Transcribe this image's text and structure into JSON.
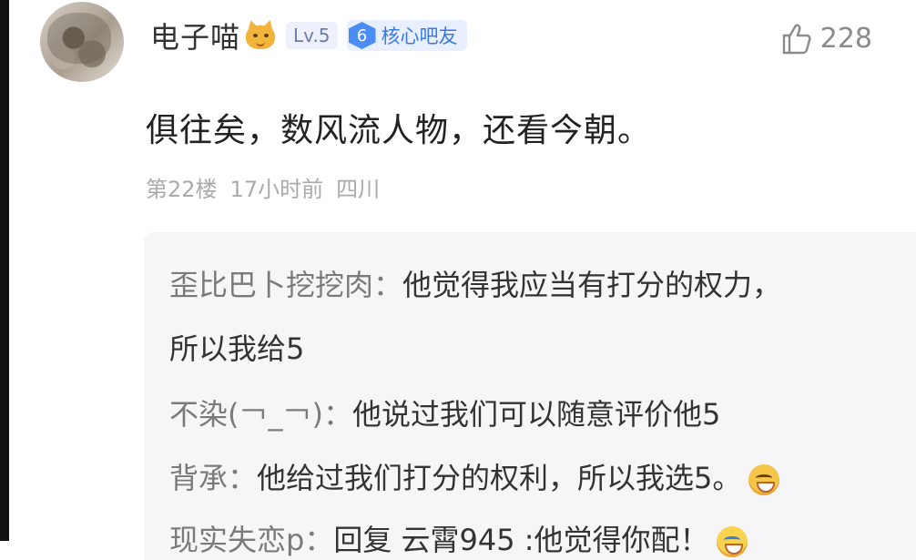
{
  "comment": {
    "username": "电子喵",
    "level": "Lv.5",
    "member_level": "6",
    "member_label": "核心吧友",
    "like_count": "228",
    "content": "俱往矣，数风流人物，还看今朝。",
    "floor": "第22楼",
    "time": "17小时前",
    "location": "四川"
  },
  "replies": [
    {
      "name": "歪比巴卜挖挖肉：",
      "text": "他觉得我应当有打分的权力，"
    },
    {
      "name": "",
      "text": "所以我给5"
    },
    {
      "name": "不染(￢_￢)：",
      "text": "他说过我们可以随意评价他5"
    },
    {
      "name": "背承：",
      "text": "他给过我们打分的权利，所以我选5。"
    },
    {
      "name": "现实失恋p：",
      "text": "回复 云霄945 :他觉得你配！"
    }
  ],
  "icons": {
    "like": "thumbs-up-icon",
    "cat": "cat-face-emoji",
    "laugh": "laughing-emoji",
    "cry": "crying-laughing-emoji"
  },
  "colors": {
    "member_badge": "#4b8df5",
    "reply_bg": "#f6f6f8",
    "meta": "#aaaaaa"
  }
}
